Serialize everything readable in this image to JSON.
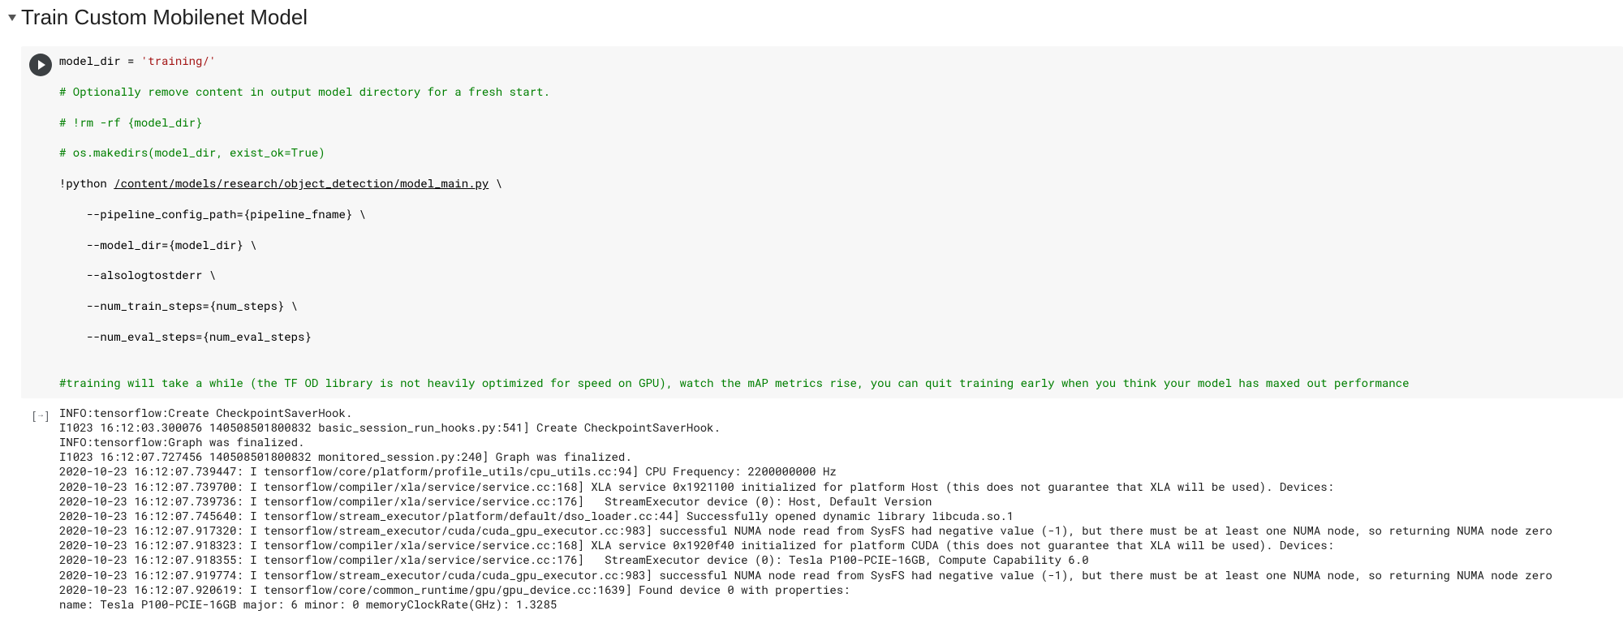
{
  "section": {
    "title": "Train Custom Mobilenet Model"
  },
  "code": {
    "l1a": "model_dir ",
    "l1b": "= ",
    "l1c": "'training/'",
    "l2": "# Optionally remove content in output model directory for a fresh start.",
    "l3": "# !rm -rf {model_dir}",
    "l4": "# os.makedirs(model_dir, exist_ok=True)",
    "l5a": "!python ",
    "l5b": "/content/models/research/object_detection/model_main.py",
    "l5c": " \\",
    "l6": "    --pipeline_config_path={pipeline_fname} \\",
    "l7": "    --model_dir={model_dir} \\",
    "l8": "    --alsologtostderr \\",
    "l9": "    --num_train_steps={num_steps} \\",
    "l10": "    --num_eval_steps={num_eval_steps}",
    "l11": "",
    "l12": "#training will take a while (the TF OD library is not heavily optimized for speed on GPU), watch the mAP metrics rise, you can quit training early when you think your model has maxed out performance"
  },
  "output": {
    "lines": [
      "INFO:tensorflow:Create CheckpointSaverHook.",
      "I1023 16:12:03.300076 140508501800832 basic_session_run_hooks.py:541] Create CheckpointSaverHook.",
      "INFO:tensorflow:Graph was finalized.",
      "I1023 16:12:07.727456 140508501800832 monitored_session.py:240] Graph was finalized.",
      "2020-10-23 16:12:07.739447: I tensorflow/core/platform/profile_utils/cpu_utils.cc:94] CPU Frequency: 2200000000 Hz",
      "2020-10-23 16:12:07.739700: I tensorflow/compiler/xla/service/service.cc:168] XLA service 0x1921100 initialized for platform Host (this does not guarantee that XLA will be used). Devices:",
      "2020-10-23 16:12:07.739736: I tensorflow/compiler/xla/service/service.cc:176]   StreamExecutor device (0): Host, Default Version",
      "2020-10-23 16:12:07.745640: I tensorflow/stream_executor/platform/default/dso_loader.cc:44] Successfully opened dynamic library libcuda.so.1",
      "2020-10-23 16:12:07.917320: I tensorflow/stream_executor/cuda/cuda_gpu_executor.cc:983] successful NUMA node read from SysFS had negative value (-1), but there must be at least one NUMA node, so returning NUMA node zero",
      "2020-10-23 16:12:07.918323: I tensorflow/compiler/xla/service/service.cc:168] XLA service 0x1920f40 initialized for platform CUDA (this does not guarantee that XLA will be used). Devices:",
      "2020-10-23 16:12:07.918355: I tensorflow/compiler/xla/service/service.cc:176]   StreamExecutor device (0): Tesla P100-PCIE-16GB, Compute Capability 6.0",
      "2020-10-23 16:12:07.919774: I tensorflow/stream_executor/cuda/cuda_gpu_executor.cc:983] successful NUMA node read from SysFS had negative value (-1), but there must be at least one NUMA node, so returning NUMA node zero",
      "2020-10-23 16:12:07.920619: I tensorflow/core/common_runtime/gpu/gpu_device.cc:1639] Found device 0 with properties:",
      "name: Tesla P100-PCIE-16GB major: 6 minor: 0 memoryClockRate(GHz): 1.3285"
    ]
  }
}
